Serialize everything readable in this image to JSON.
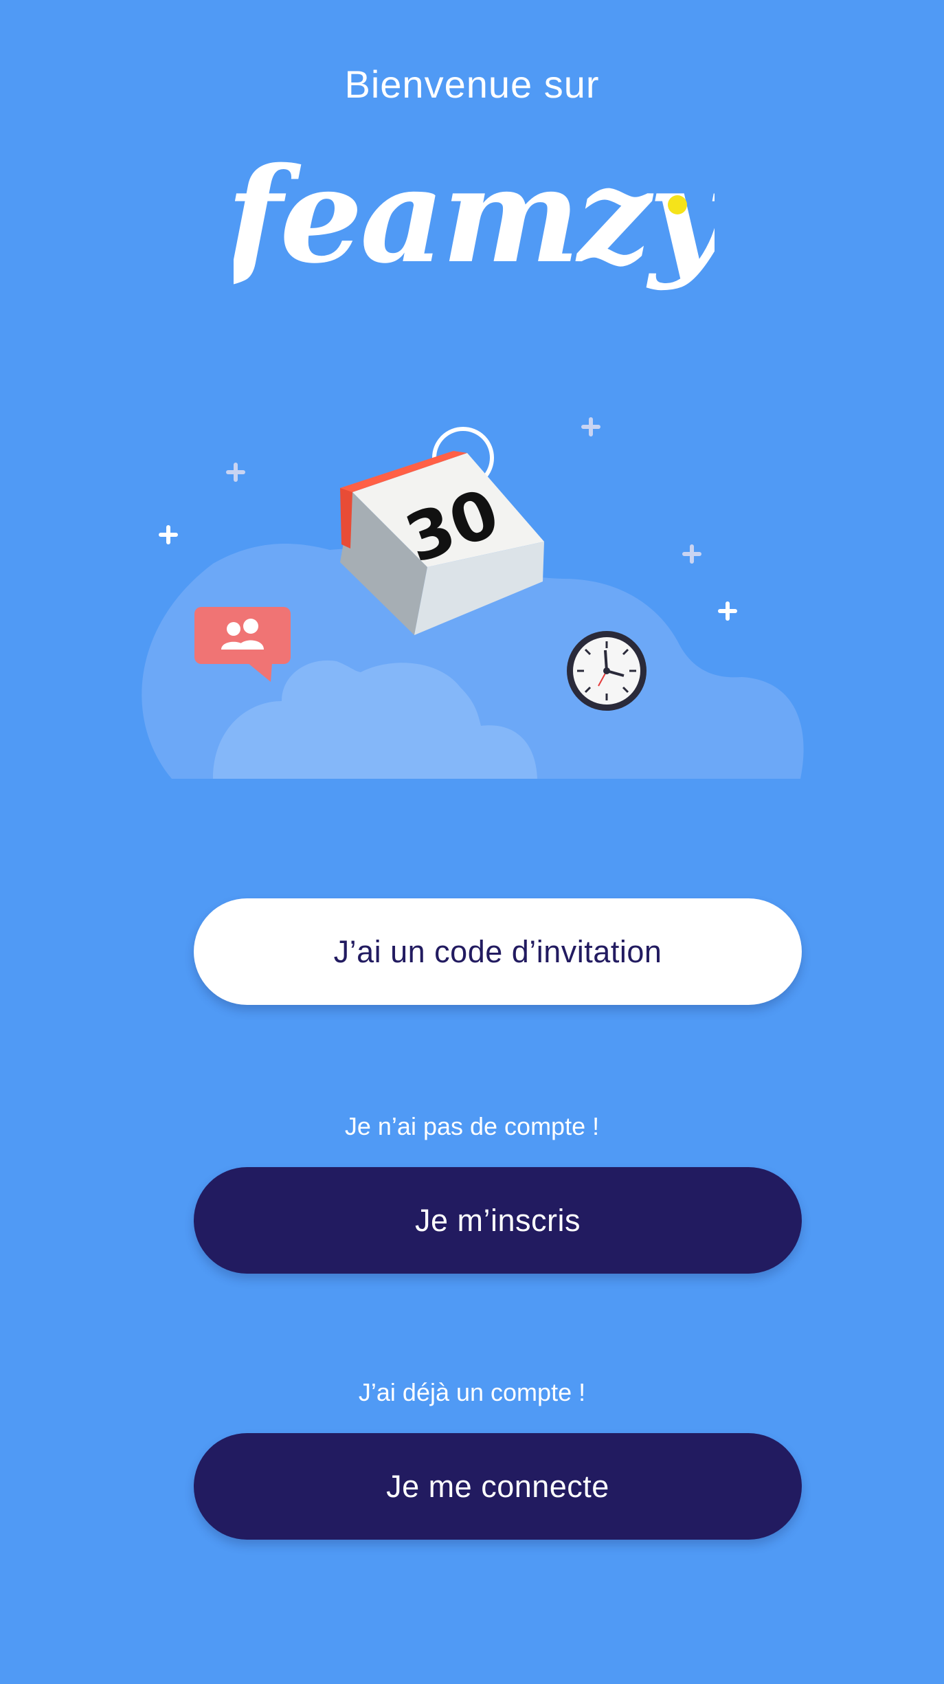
{
  "header": {
    "welcome_text": "Bienvenue sur",
    "logo_text": "feamzy"
  },
  "illustration": {
    "calendar_day": "30"
  },
  "actions": {
    "invite_button_label": "J’ai un code d’invitation",
    "signup_hint": "Je n’ai pas de compte !",
    "signup_button_label": "Je m’inscris",
    "login_hint": "J’ai déjà un compte !",
    "login_button_label": "Je me connecte"
  },
  "colors": {
    "background": "#509AF5",
    "dark_navy": "#221B60",
    "white": "#FFFFFF",
    "logo_dot": "#F5E31A",
    "calendar_red": "#FF6046",
    "chat_bubble": "#F07474"
  },
  "icons": [
    "calendar-icon",
    "clock-icon",
    "group-chat-icon",
    "sparkle-plus-icon"
  ]
}
